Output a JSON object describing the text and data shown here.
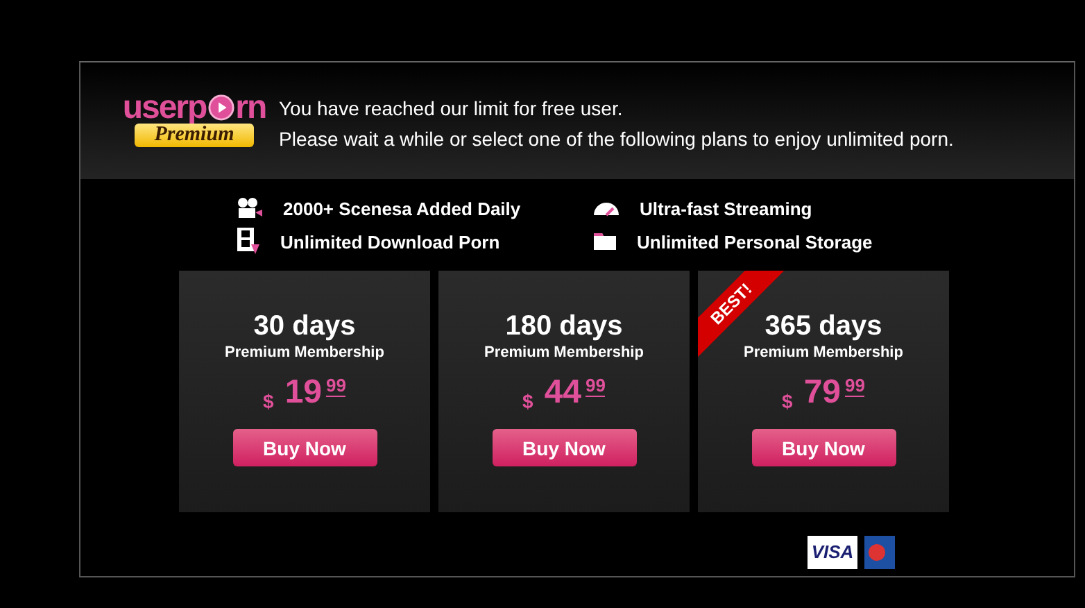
{
  "header": {
    "logo": {
      "left": "userp",
      "right": "rn",
      "badge": "Premium"
    },
    "message": [
      "You have reached our limit for free user.",
      "Please wait a while or select one of the following plans to enjoy unlimited porn."
    ]
  },
  "features": [
    {
      "label": "2000+ Scenesa Added Daily",
      "kind": "camera"
    },
    {
      "label": "Ultra-fast Streaming",
      "kind": "gauge"
    },
    {
      "label": "Unlimited Download Porn",
      "kind": "download"
    },
    {
      "label": "Unlimited Personal Storage",
      "kind": "folder"
    }
  ],
  "plans": [
    {
      "duration": "30 days",
      "subtitle": "Premium Membership",
      "currency": "$",
      "amount": "19",
      "cents": "99",
      "button": "Buy Now"
    },
    {
      "duration": "180 days",
      "subtitle": "Premium Membership",
      "currency": "$",
      "amount": "44",
      "cents": "99",
      "button": "Buy Now"
    },
    {
      "duration": "365 days",
      "subtitle": "Premium Membership",
      "currency": "$",
      "amount": "79",
      "cents": "99",
      "button": "Buy Now",
      "ribbon": "BEST!"
    }
  ],
  "payment_cards": [
    {
      "kind": "visa",
      "label": "VISA"
    },
    {
      "kind": "card"
    }
  ]
}
